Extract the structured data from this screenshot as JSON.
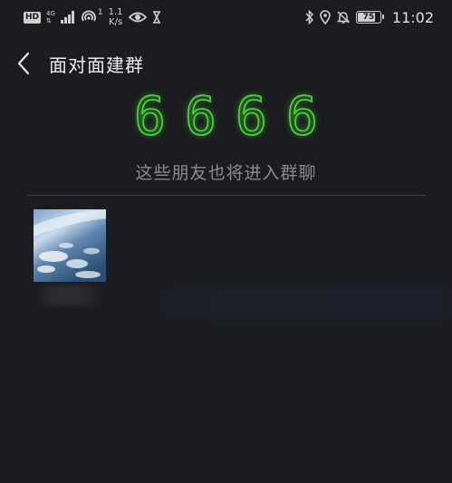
{
  "status_bar": {
    "hd_label": "HD",
    "network_label": "4G",
    "hotspot_count": "1",
    "speed_value": "1.1",
    "speed_unit": "K/s",
    "battery_level": "75",
    "time": "11:02",
    "icons": [
      "hd-icon",
      "signal-icon",
      "hotspot-icon",
      "eye-icon",
      "hourglass-icon",
      "bluetooth-icon",
      "location-icon",
      "bell-off-icon",
      "battery-icon"
    ]
  },
  "header": {
    "back_icon": "chevron-left-icon",
    "title": "面对面建群"
  },
  "code": {
    "digits": [
      "6",
      "6",
      "6",
      "6"
    ],
    "color": "#49d13a"
  },
  "hint": "这些朋友也将进入群聊",
  "members": [
    {
      "avatar": "sky-clouds-photo"
    }
  ]
}
